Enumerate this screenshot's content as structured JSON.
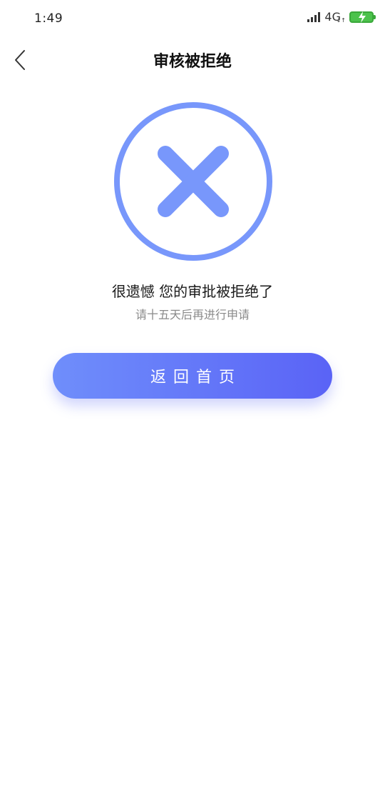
{
  "status_bar": {
    "time": "1:49",
    "network": "4G",
    "network_arrows": "↓↑",
    "battery_color": "#4cc24c"
  },
  "nav": {
    "title": "审核被拒绝",
    "back_icon": "chevron-left-icon"
  },
  "result": {
    "icon": "close-circle-icon",
    "icon_color": "#7897fb",
    "message": "很遗憾 您的审批被拒绝了",
    "sub_message": "请十五天后再进行申请"
  },
  "actions": {
    "home_label": "返回首页",
    "home_gradient_start": "#6f8efb",
    "home_gradient_end": "#5a63f6"
  }
}
